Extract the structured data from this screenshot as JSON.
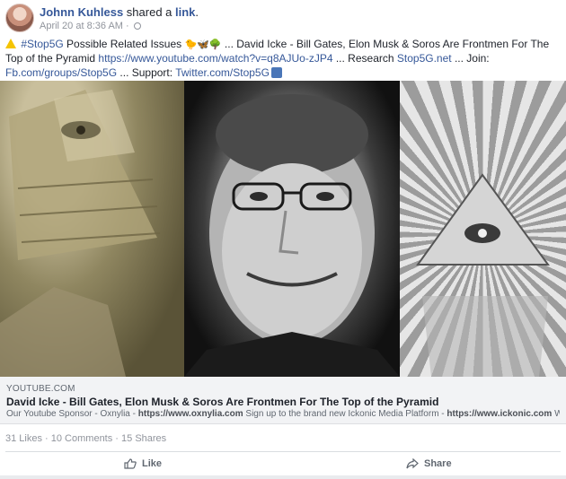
{
  "header": {
    "author": "Johnn Kuhless",
    "shared_prefix": " shared a ",
    "shared_object": "link",
    "shared_suffix": ".",
    "timestamp": "April 20 at 8:36 AM",
    "separator": " · "
  },
  "post": {
    "hashtag": "#Stop5G",
    "text1": " Possible Related Issues ",
    "emojis": "🐤🦋🌳",
    "text2": " ... David Icke - Bill Gates, Elon Musk & Soros Are Frontmen For The Top of the Pyramid ",
    "youtube_url": "https://www.youtube.com/watch?v=q8AJUo-zJP4",
    "text3": " ... Research ",
    "research_link": "Stop5G.net",
    "text4": " ... Join: ",
    "join_link": "Fb.com/groups/Stop5G",
    "text5": " ... Support: ",
    "support_link": "Twitter.com/Stop5G"
  },
  "link_preview": {
    "domain": "YOUTUBE.COM",
    "title": "David Icke - Bill Gates, Elon Musk & Soros Are Frontmen For The Top of the Pyramid",
    "desc_part1": "Our Youtube Sponsor - Oxnylia - ",
    "desc_link1": "https://www.oxnylia.com",
    "desc_part2": " Sign up to the brand new Ickonic Media Platform - ",
    "desc_link2": "https://www.ickonic.com",
    "desc_part3": " World Tour Tick..."
  },
  "counts": {
    "likes": "31 Likes",
    "comments": "10 Comments",
    "shares": "15 Shares",
    "sep": " · "
  },
  "actions": {
    "like_label": "Like",
    "share_label": "Share"
  },
  "icons": {
    "avatar": "avatar",
    "globe": "globe-icon",
    "warning": "warning-icon",
    "thumbs_up": "thumbs-up-icon",
    "like": "like-icon",
    "share": "share-icon"
  },
  "colors": {
    "link": "#365899",
    "muted": "#90949c",
    "card_bg": "#f2f3f5"
  }
}
